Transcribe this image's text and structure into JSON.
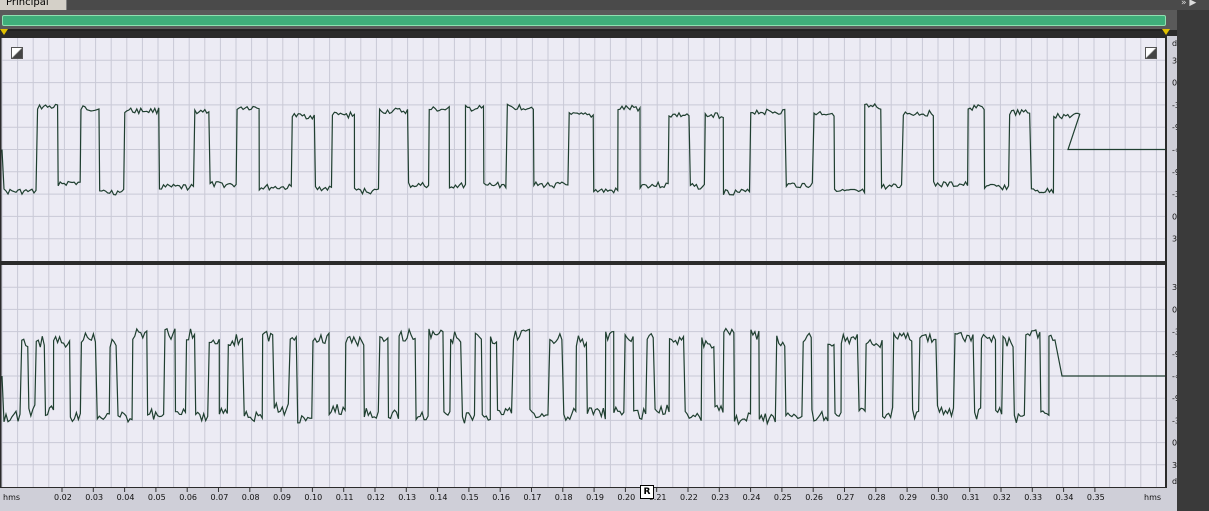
{
  "tab": {
    "label": "Principal"
  },
  "db_scale": {
    "unit": "dB",
    "labels": [
      "3",
      "0",
      "-3",
      "-9",
      "-∞",
      "-9",
      "-3",
      "0",
      "3"
    ]
  },
  "time_ruler": {
    "unit": "hms",
    "ticks": [
      "0.02",
      "0.03",
      "0.04",
      "0.05",
      "0.06",
      "0.07",
      "0.08",
      "0.09",
      "0.10",
      "0.11",
      "0.12",
      "0.13",
      "0.14",
      "0.15",
      "0.16",
      "0.17",
      "0.18",
      "0.19",
      "0.20",
      "0.21",
      "0.22",
      "0.23",
      "0.24",
      "0.25",
      "0.26",
      "0.27",
      "0.28",
      "0.29",
      "0.30",
      "0.31",
      "0.32",
      "0.33",
      "0.34",
      "0.35"
    ]
  },
  "cursor_badge": "R",
  "colors": {
    "waveform": "#1f3f30",
    "background": "#ecebf4",
    "selection": "#3fae7a"
  }
}
